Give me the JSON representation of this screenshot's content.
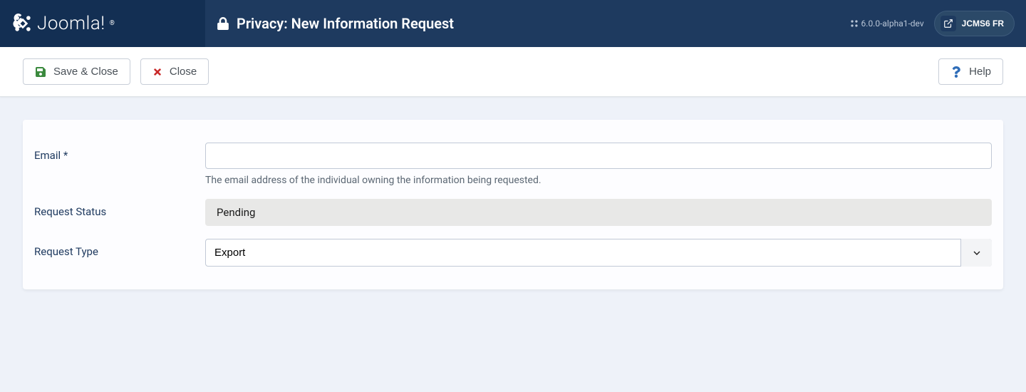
{
  "brand": {
    "name": "Joomla!"
  },
  "header": {
    "title": "Privacy: New Information Request",
    "version": "6.0.0-alpha1-dev",
    "site_name": "JCMS6 FR"
  },
  "toolbar": {
    "save_label": "Save & Close",
    "close_label": "Close",
    "help_label": "Help"
  },
  "form": {
    "email": {
      "label": "Email *",
      "value": "",
      "description": "The email address of the individual owning the information being requested."
    },
    "status": {
      "label": "Request Status",
      "value": "Pending"
    },
    "type": {
      "label": "Request Type",
      "value": "Export"
    }
  }
}
